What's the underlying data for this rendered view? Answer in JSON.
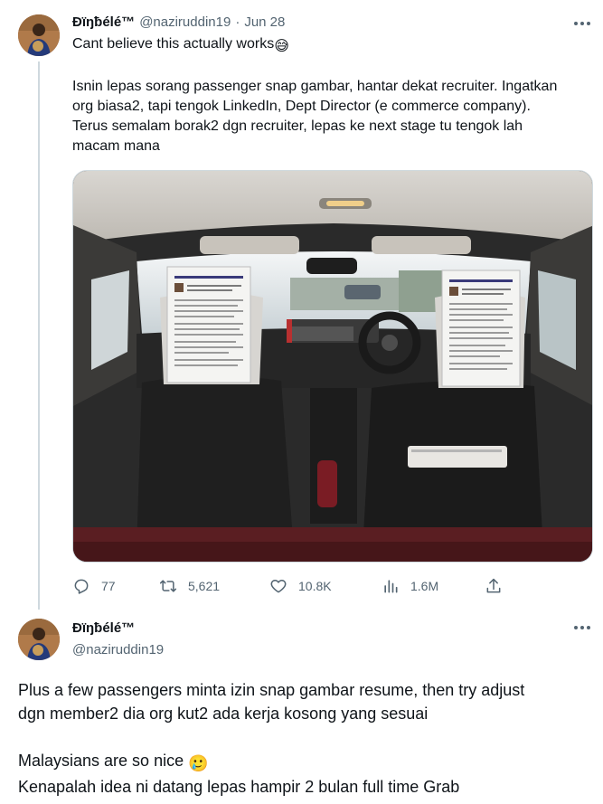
{
  "tweet1": {
    "display_name": "Đïŋƀélé™",
    "handle": "@naziruddin19",
    "separator": "·",
    "date": "Jun 28",
    "text_line1": "Cant believe this actually works",
    "text_line1_emoji": "😅",
    "paragraph2": [
      "Isnin lepas sorang passenger snap gambar, hantar dekat recruiter. Ingatkan",
      "org biasa2, tapi tengok LinkedIn, Dept Director (e commerce company).",
      "Terus semalam borak2 dgn recruiter, lepas ke next stage tu tengok lah",
      "macam mana"
    ],
    "metrics": {
      "replies": "77",
      "retweets": "5,621",
      "likes": "10.8K",
      "views": "1.6M"
    }
  },
  "tweet2": {
    "display_name": "Đïŋƀélé™",
    "handle": "@naziruddin19",
    "paragraph1": [
      "Plus a few passengers minta izin snap gambar resume, then try adjust",
      "dgn member2 dia org kut2 ada kerja kosong yang sesuai"
    ],
    "line3": "Malaysians are so nice",
    "line3_emoji": "🥲",
    "line4": "Kenapalah idea ni datang lepas hampir 2 bulan full time Grab"
  },
  "icons": {
    "reply": "reply-icon",
    "retweet": "retweet-icon",
    "like": "heart-icon",
    "views": "views-icon",
    "share": "share-icon",
    "more": "more-icon"
  },
  "colors": {
    "text": "#0f1419",
    "secondary": "#536471",
    "divider": "#cfd9de"
  }
}
